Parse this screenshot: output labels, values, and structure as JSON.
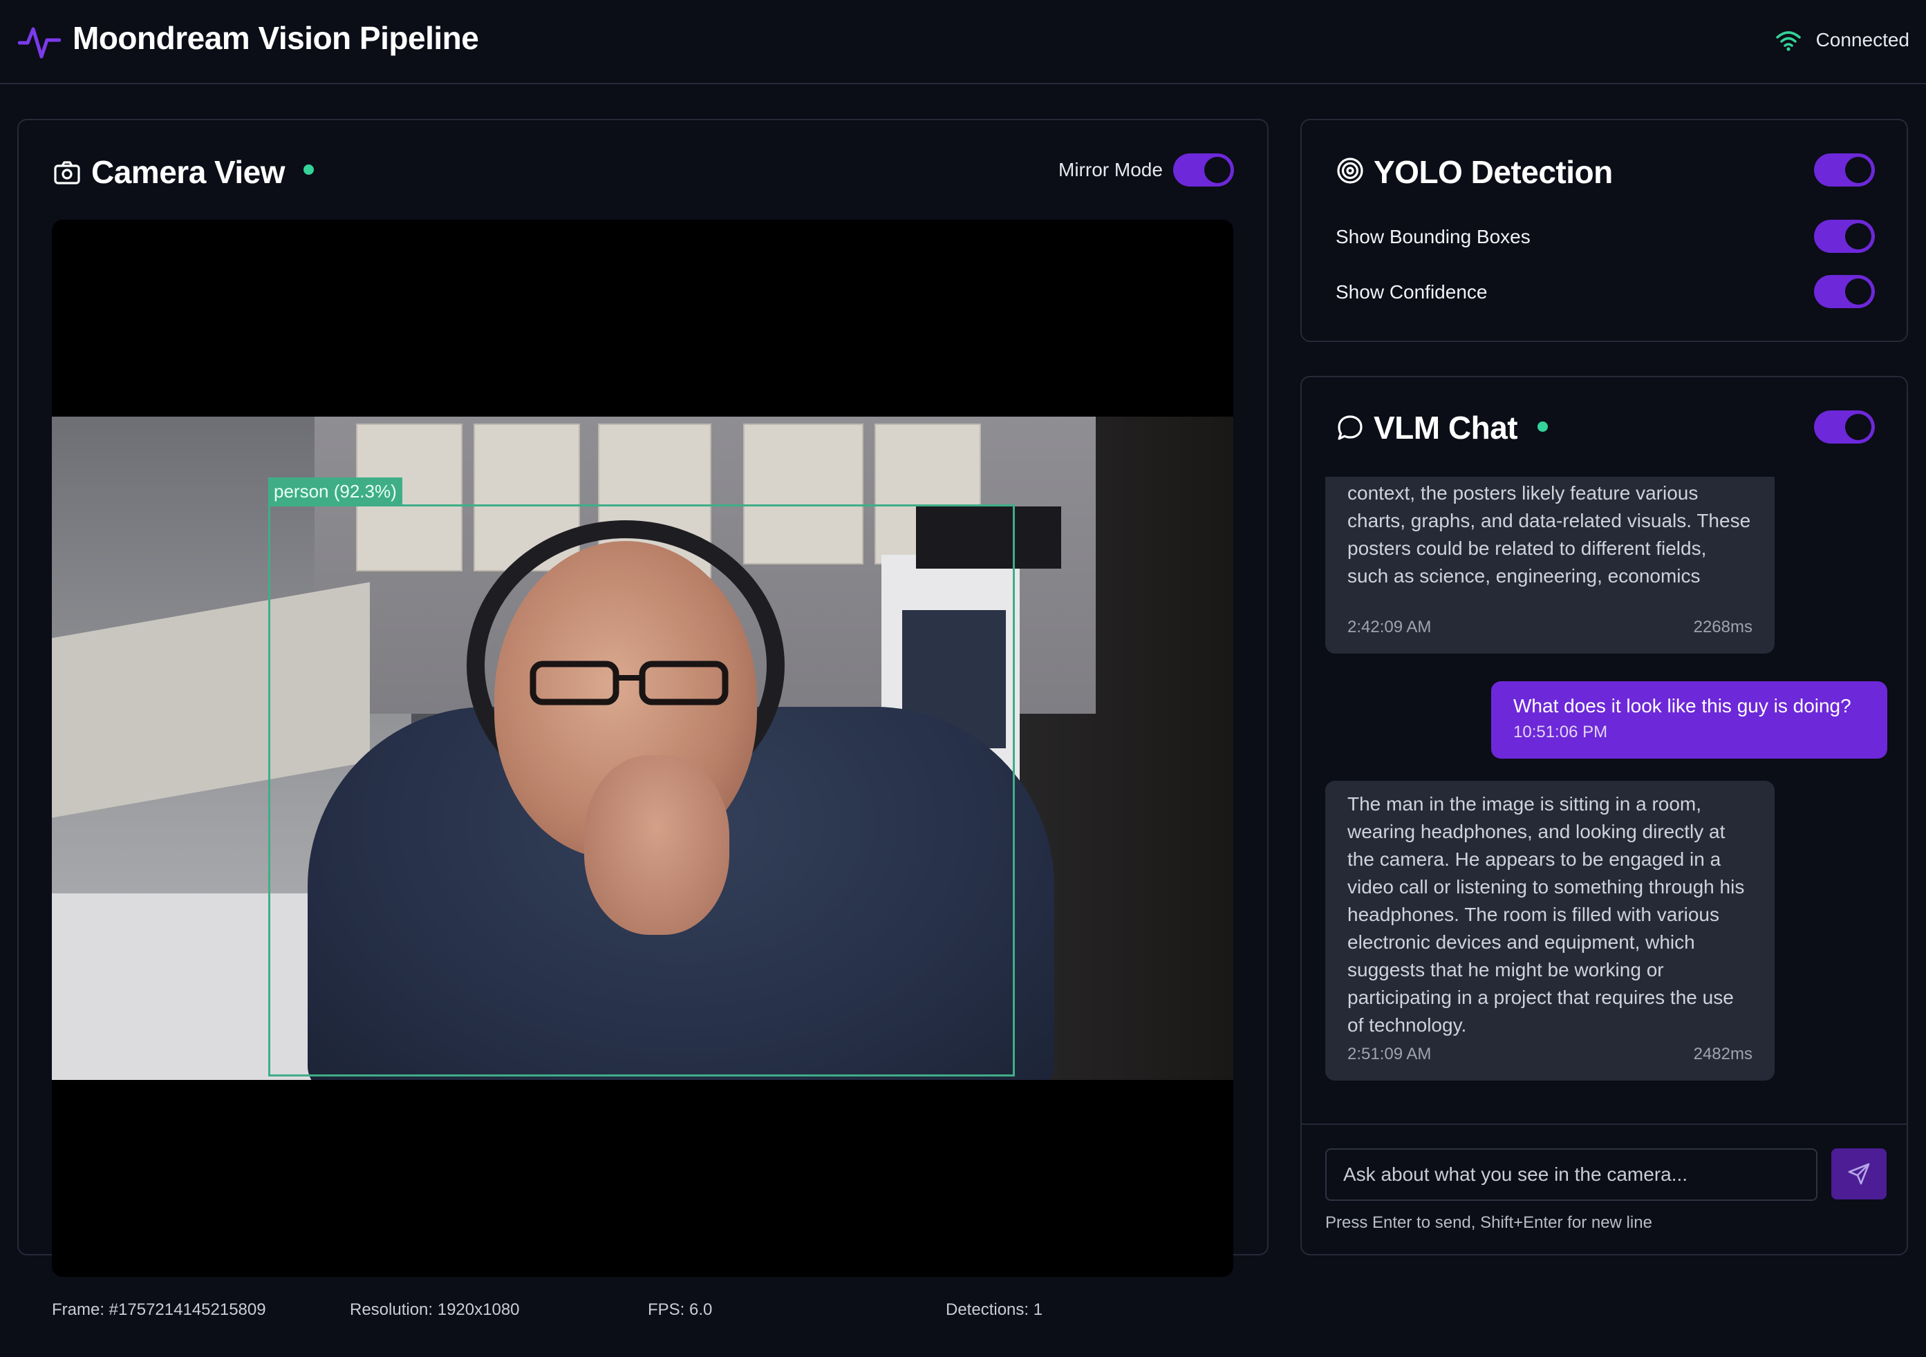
{
  "header": {
    "title": "Moondream Vision Pipeline",
    "status": "Connected",
    "logo_icon": "activity-pulse-icon",
    "status_icon": "wifi-icon",
    "accent": "#7c3aed",
    "status_color": "#34d399"
  },
  "camera": {
    "title": "Camera View",
    "mirror_label": "Mirror Mode",
    "mirror_on": true,
    "detection_label": "person (92.3%)",
    "stats": {
      "frame": "Frame: #1757214145215809",
      "resolution": "Resolution: 1920x1080",
      "fps": "FPS: 6.0",
      "detections": "Detections: 1"
    }
  },
  "yolo": {
    "title": "YOLO Detection",
    "enabled": true,
    "options": [
      {
        "label": "Show Bounding Boxes",
        "on": true
      },
      {
        "label": "Show Confidence",
        "on": true
      }
    ]
  },
  "chat": {
    "title": "VLM Chat",
    "enabled": true,
    "messages": [
      {
        "role": "assistant",
        "text": "context, the posters likely feature various charts, graphs, and data-related visuals. These posters could be related to different fields, such as science, engineering, economics",
        "time": "2:42:09 AM",
        "latency": "2268ms"
      },
      {
        "role": "user",
        "text": "What does it look like this guy is doing?",
        "time": "10:51:06 PM"
      },
      {
        "role": "assistant",
        "text": "The man in the image is sitting in a room, wearing headphones, and looking directly at the camera. He appears to be engaged in a video call or listening to something through his headphones. The room is filled with various electronic devices and equipment, which suggests that he might be working or participating in a project that requires the use of technology.",
        "time": "2:51:09 AM",
        "latency": "2482ms"
      }
    ],
    "input_placeholder": "Ask about what you see in the camera...",
    "input_value": "",
    "hint": "Press Enter to send, Shift+Enter for new line",
    "send_icon": "send-icon"
  }
}
